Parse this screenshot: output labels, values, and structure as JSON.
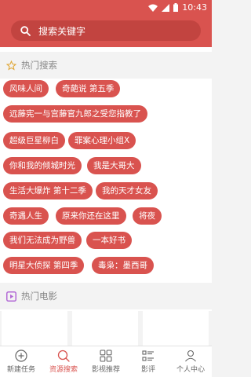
{
  "status_bar": {
    "time": "10:43"
  },
  "search": {
    "placeholder": "搜索关键字"
  },
  "hot_search": {
    "title": "热门搜索",
    "tags": [
      "风味人间",
      "奇葩说 第五季",
      "远藤宪一与宫藤官九郎之受您指教了",
      "超级巨星柳白",
      "罪案心理小组X",
      "你和我的倾城时光",
      "我是大哥大",
      "生活大爆炸 第十二季",
      "我的天才女友",
      "奇遇人生",
      "原来你还在这里",
      "将夜",
      "我们无法成为野兽",
      "一本好书",
      "明星大侦探 第四季",
      "毒枭：墨西哥"
    ]
  },
  "hot_movies": {
    "title": "热门电影"
  },
  "tab_bar": {
    "items": [
      {
        "label": "新建任务",
        "icon": "plus-circle-icon"
      },
      {
        "label": "资源搜索",
        "icon": "search-icon"
      },
      {
        "label": "影视推荐",
        "icon": "grid-icon"
      },
      {
        "label": "影评",
        "icon": "list-icon"
      },
      {
        "label": "个人中心",
        "icon": "person-icon"
      }
    ],
    "active_index": 1
  },
  "colors": {
    "accent": "#d9534f",
    "search_bg": "#c24440",
    "section_bg": "#f3f3f3"
  }
}
